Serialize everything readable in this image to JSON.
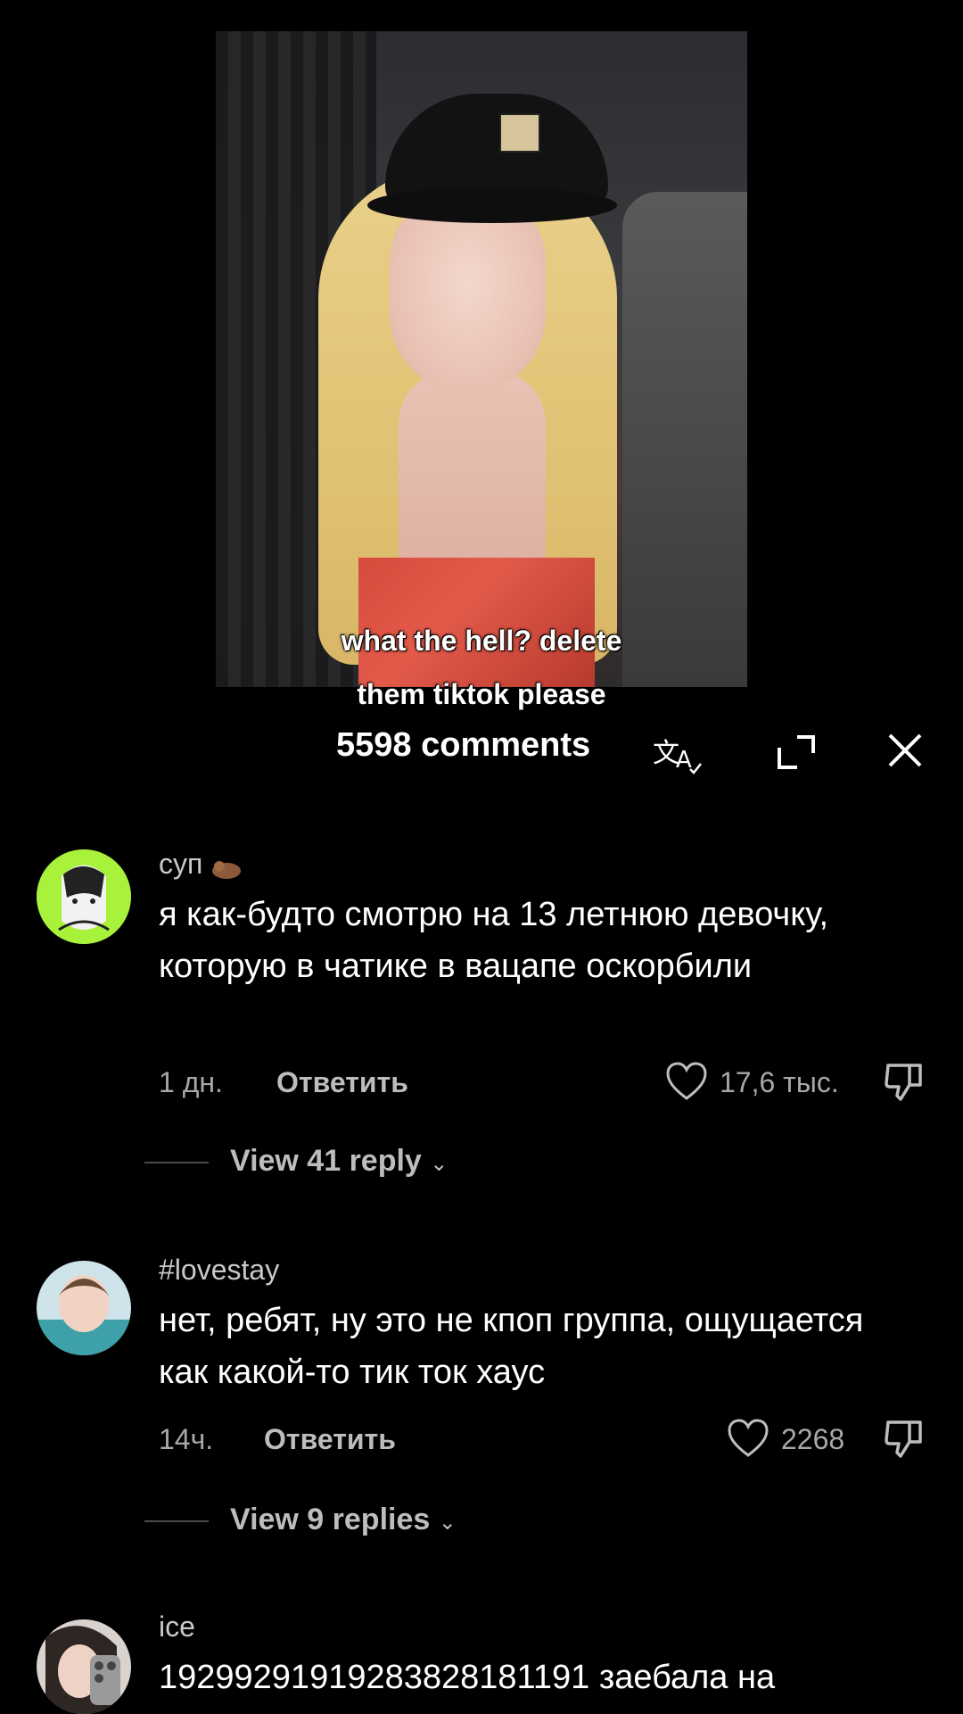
{
  "video": {
    "caption_line1": "what the hell? delete",
    "caption_line2": "them tiktok please"
  },
  "header": {
    "comments_label": "5598 comments"
  },
  "icons": {
    "translate": "translate-icon",
    "expand": "expand-icon",
    "close": "close-icon",
    "like": "heart-icon",
    "dislike": "dislike-icon"
  },
  "comments": [
    {
      "username": "суп",
      "text": "я как-будто смотрю на 13 летнюю девочку, которую в чатике в вацапе оскорбили",
      "time": "1 дн.",
      "reply_label": "Ответить",
      "likes": "17,6 тыс.",
      "view_replies": "View 41 reply"
    },
    {
      "username": "#lovestay",
      "text": "нет, ребят, ну это не кпоп группа, ощущается как какой-то тик ток хаус",
      "time": "14ч.",
      "reply_label": "Ответить",
      "likes": "2268",
      "view_replies": "View 9 replies"
    },
    {
      "username": "ice",
      "text": "19299291919283828181191 заебала на"
    }
  ],
  "colors": {
    "background": "#000000",
    "secondary_text": "#a8a8a8",
    "primary_text": "#ffffff"
  }
}
